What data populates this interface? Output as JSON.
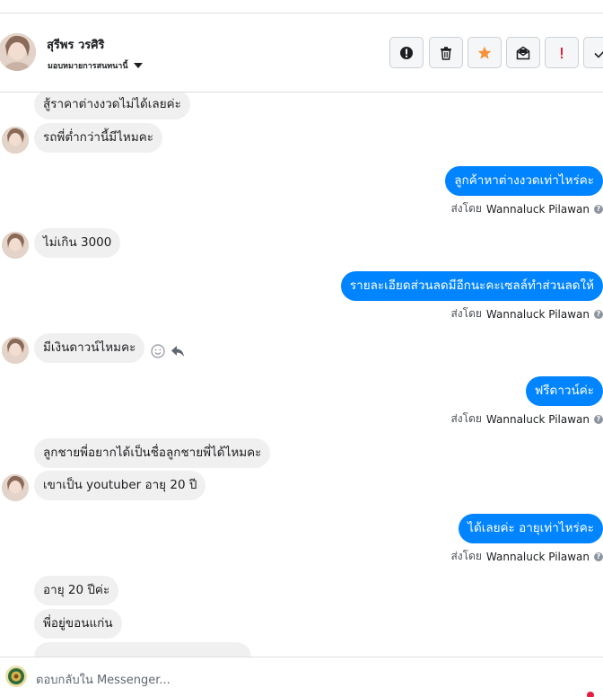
{
  "header": {
    "contact_name": "สุรีพร วรศิริ",
    "assign_label": "มอบหมายการสนทนานี้"
  },
  "actions": [
    {
      "name": "ผู้ไม่ส่งเสริมการขาย",
      "icon": "alert-circle-icon"
    },
    {
      "name": "delete",
      "icon": "trash-icon"
    },
    {
      "name": "star",
      "icon": "star-icon",
      "color": "#f7923a"
    },
    {
      "name": "mark-unread",
      "icon": "envelope-icon"
    },
    {
      "name": "spam",
      "icon": "exclamation-icon",
      "color": "#e41e3f"
    },
    {
      "name": "done",
      "icon": "check-icon"
    }
  ],
  "messages": [
    {
      "dir": "in",
      "text": "สู้ราคาต่างงวดไม่ได้เลยค่ะ"
    },
    {
      "dir": "in",
      "text": "รถพี่ต่ำกว่านี้มีไหมคะ"
    },
    {
      "dir": "out",
      "text": "ลูกค้าหาต่างงวดเท่าไหร่คะ"
    },
    {
      "dir": "in",
      "text": "ไม่เกิน 3000"
    },
    {
      "dir": "out",
      "text": "รายละเอียดส่วนลดมีอีกนะคะเซลล์ทำส่วนลดให้"
    },
    {
      "dir": "in",
      "text": "มีเงินดาวน์ไหมคะ"
    },
    {
      "dir": "out",
      "text": "ฟรีดาวน์ค่ะ"
    },
    {
      "dir": "in",
      "text": "ลูกชายพี่อยากได้เป็นชื่อลูกชายพี่ได้ไหมคะ"
    },
    {
      "dir": "in",
      "text": "เขาเป็น youtuber อายุ 20 ปี"
    },
    {
      "dir": "out",
      "text": "ได้เลยค่ะ  อายุเท่าไหร่คะ"
    },
    {
      "dir": "in",
      "text": "อายุ 20 ปีค่ะ"
    },
    {
      "dir": "in",
      "text": "พี่อยู่ขอนแก่น"
    }
  ],
  "sent_by": {
    "prefix": "ส่งโดย",
    "agent": "Wannaluck Pilawan"
  },
  "composer": {
    "placeholder": "ตอบกลับใน Messenger..."
  },
  "colors": {
    "outgoing_bubble": "#0084ff",
    "incoming_bubble": "#f1f0f0",
    "star": "#f7923a",
    "alert_red": "#e41e3f"
  }
}
